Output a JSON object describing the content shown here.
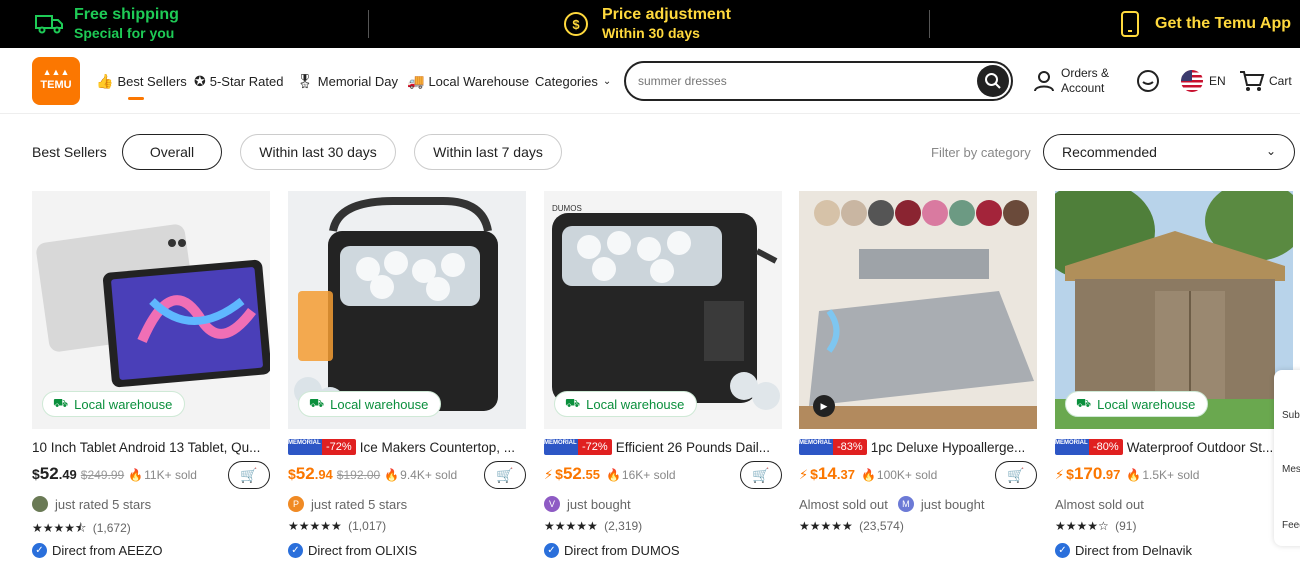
{
  "promo": {
    "shipping_title": "Free shipping",
    "shipping_sub": "Special for you",
    "price_title": "Price adjustment",
    "price_sub": "Within 30 days",
    "app": "Get the Temu App"
  },
  "header": {
    "logo": "TEMU",
    "nav": [
      {
        "label": "Best Sellers",
        "icon": "thumbs-up-icon"
      },
      {
        "label": "5-Star Rated",
        "icon": "star-badge-icon"
      },
      {
        "label": "Memorial Day",
        "icon": "medal-icon"
      },
      {
        "label": "Local Warehouse",
        "icon": "truck-icon"
      },
      {
        "label": "Categories",
        "icon": "chevron-down-icon"
      }
    ],
    "search_placeholder": "summer dresses",
    "orders": "Orders &",
    "account": "Account",
    "lang": "EN",
    "cart": "Cart"
  },
  "filters": {
    "label": "Best Sellers",
    "pills": [
      "Overall",
      "Within last 30 days",
      "Within last 7 days"
    ],
    "filter_by": "Filter by category",
    "sort": "Recommended"
  },
  "local_warehouse": "Local warehouse",
  "products": [
    {
      "title": "10 Inch Tablet Android 13 Tablet, Qu...",
      "price_sym": "$",
      "price_int": "52",
      "price_cents": ".49",
      "was": "$249.99",
      "sold": "11K+ sold",
      "social": "just rated 5 stars",
      "stars": "★★★★⯪",
      "reviews": "(1,672)",
      "direct": "Direct from AEEZO"
    },
    {
      "badge": "MEMORIAL DAY",
      "discount": "-72%",
      "title": "Ice Makers Countertop, ...",
      "price_sym": "$",
      "price_int": "52",
      "price_cents": ".94",
      "was": "$192.00",
      "sold": "9.4K+ sold",
      "avatar": "P",
      "social": "just rated 5 stars",
      "stars": "★★★★★",
      "reviews": "(1,017)",
      "direct": "Direct from OLIXIS"
    },
    {
      "badge": "MEMORIAL DAY",
      "discount": "-72%",
      "title": "Efficient 26 Pounds Dail...",
      "price_sym": "$",
      "price_int": "52",
      "price_cents": ".55",
      "sold": "16K+ sold",
      "avatar": "V",
      "social": "just bought",
      "stars": "★★★★★",
      "reviews": "(2,319)",
      "direct": "Direct from DUMOS"
    },
    {
      "badge": "MEMORIAL DAY",
      "discount": "-83%",
      "title": "1pc Deluxe Hypoallerge...",
      "price_sym": "$",
      "price_int": "14",
      "price_cents": ".37",
      "sold": "100K+ sold",
      "almost": "Almost sold out",
      "avatar": "M",
      "social": "just bought",
      "stars": "★★★★★",
      "reviews": "(23,574)"
    },
    {
      "badge": "MEMORIAL DAY",
      "discount": "-80%",
      "title": "Waterproof Outdoor St...",
      "price_sym": "$",
      "price_int": "170",
      "price_cents": ".97",
      "sold": "1.5K+ sold",
      "almost": "Almost sold out",
      "stars": "★★★★☆",
      "reviews": "(91)",
      "direct": "Direct from Delnavik"
    }
  ],
  "float": [
    "Sub",
    "Mes",
    "Feed"
  ],
  "colors": {
    "accent": "#fb7701",
    "green": "#0a8f3c",
    "promo_green": "#1ecb56",
    "promo_yellow": "#ffd93d",
    "badge_blue": "#2d56c5",
    "discount_red": "#e02020"
  }
}
